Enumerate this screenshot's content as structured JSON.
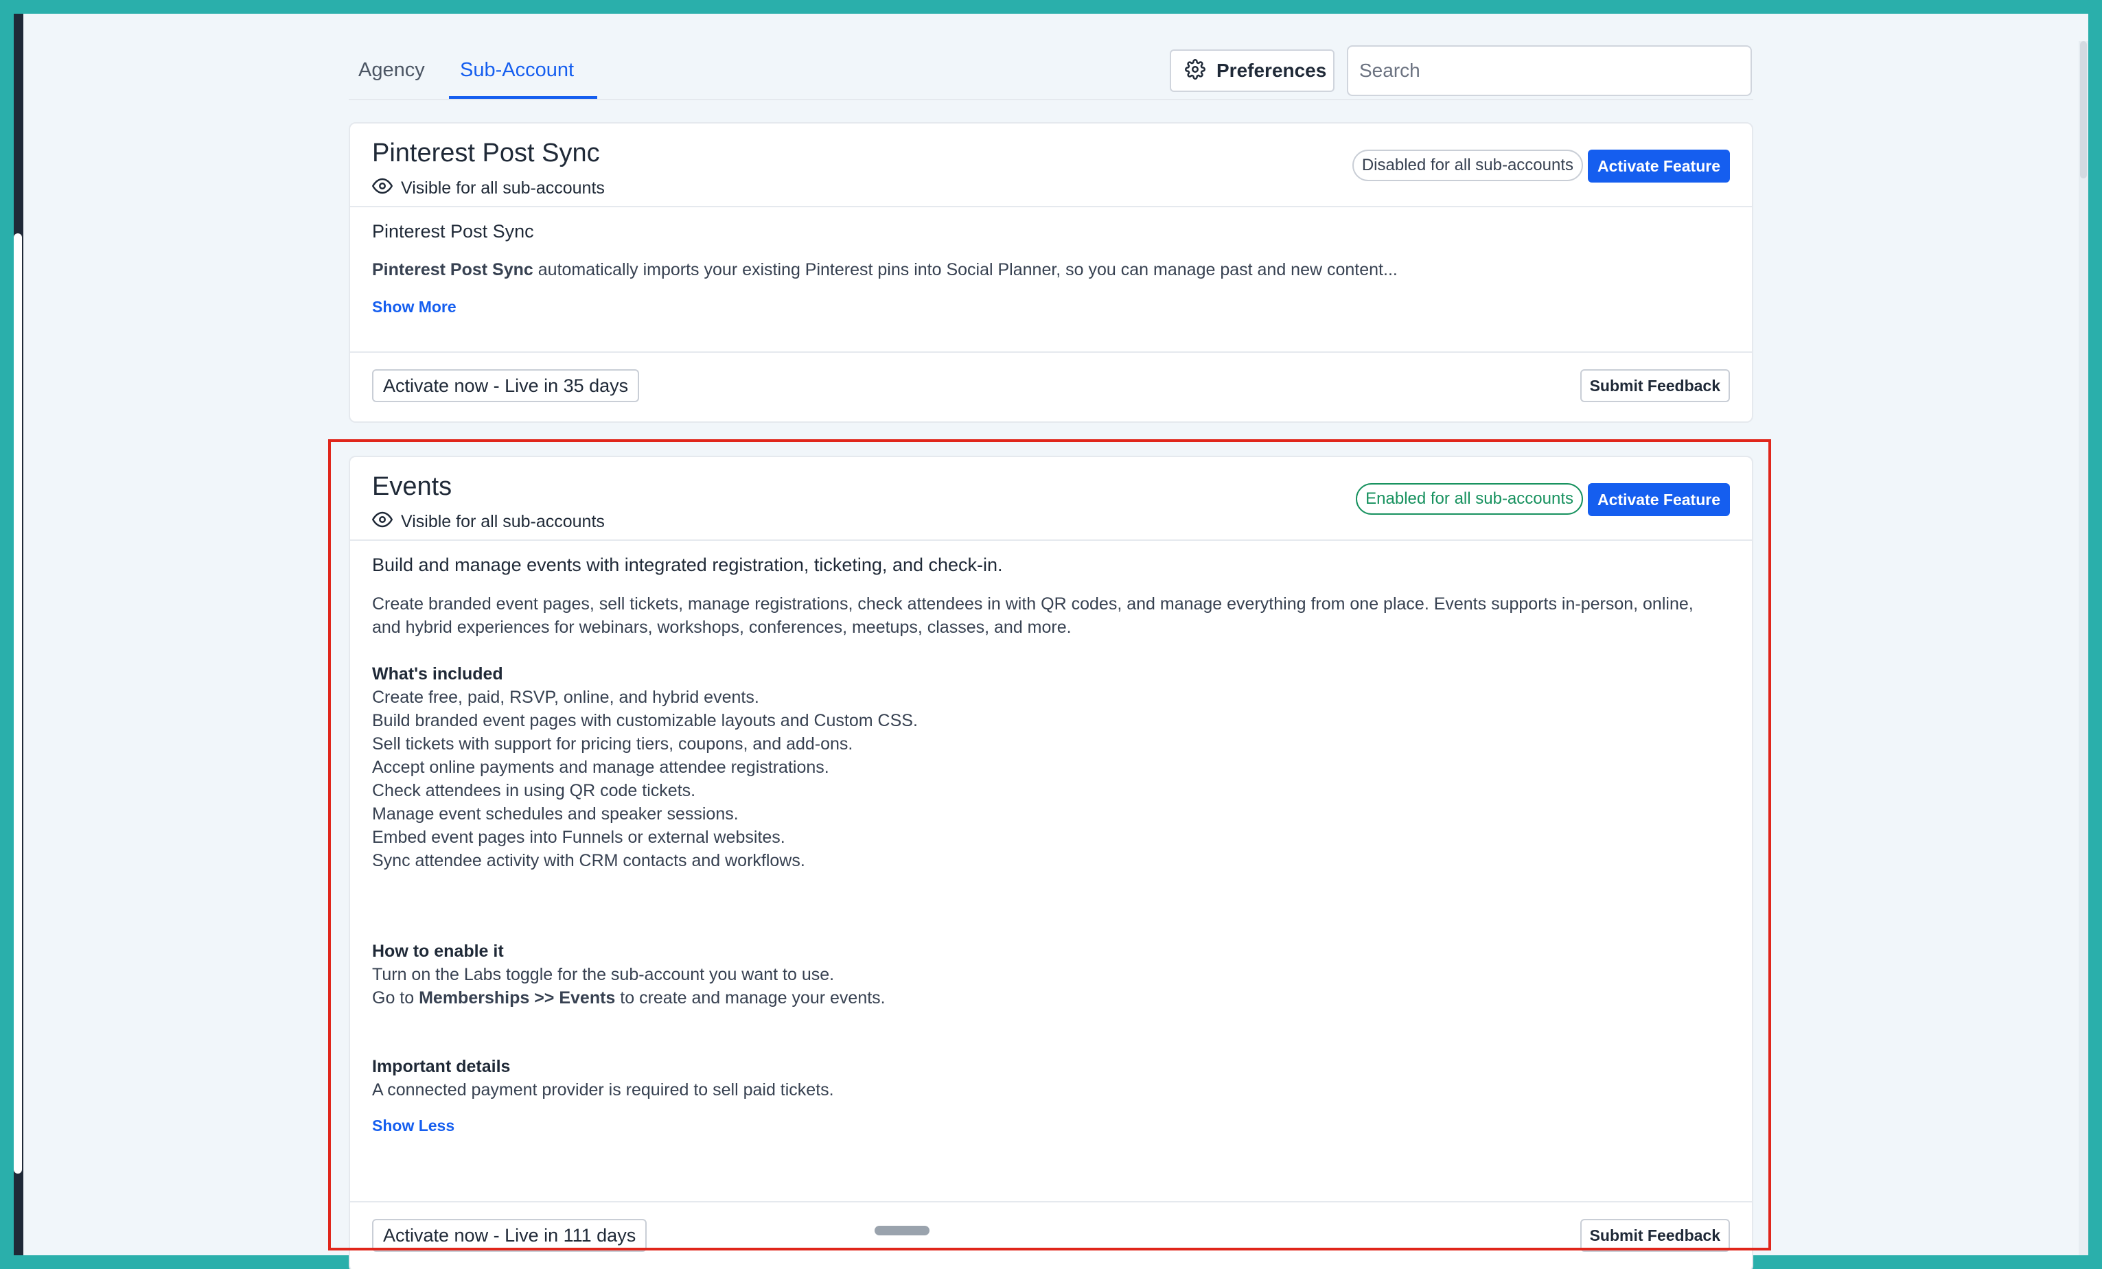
{
  "tabs": {
    "agency": "Agency",
    "sub_account": "Sub-Account"
  },
  "toolbar": {
    "preferences_label": "Preferences",
    "search_placeholder": "Search"
  },
  "cards": [
    {
      "title": "Pinterest Post Sync",
      "visibility": "Visible for all sub-accounts",
      "status": "Disabled for all sub-accounts",
      "activate_label": "Activate Feature",
      "subtitle": "Pinterest Post Sync",
      "desc_bold": "Pinterest Post Sync",
      "desc_rest": " automatically imports your existing Pinterest pins into Social Planner, so you can manage past and new content...",
      "toggle_label": "Show More",
      "live_label": "Activate now - Live in 35 days",
      "feedback_label": "Submit Feedback"
    },
    {
      "title": "Events",
      "visibility": "Visible for all sub-accounts",
      "status": "Enabled for all sub-accounts",
      "activate_label": "Activate Feature",
      "lead": "Build and manage events with integrated registration, ticketing, and check-in.",
      "intro_line1": "Create branded event pages, sell tickets, manage registrations, check attendees in with QR codes, and manage everything from one place. Events supports in-person, online,",
      "intro_line2": "and hybrid experiences for webinars, workshops, conferences, meetups, classes, and more.",
      "included_heading": "What's included",
      "included_items": [
        "Create free, paid, RSVP, online, and hybrid events.",
        "Build branded event pages with customizable layouts and Custom CSS.",
        "Sell tickets with support for pricing tiers, coupons, and add-ons.",
        "Accept online payments and manage attendee registrations.",
        "Check attendees in using QR code tickets.",
        "Manage event schedules and speaker sessions.",
        "Embed event pages into Funnels or external websites.",
        "Sync attendee activity with CRM contacts and workflows."
      ],
      "enable_heading": "How to enable it",
      "enable_line1": "Turn on the Labs toggle for the sub-account you want to use.",
      "enable_line2_pre": "Go to ",
      "enable_line2_bold": "Memberships >> Events",
      "enable_line2_post": " to create and manage your events.",
      "details_heading": "Important details",
      "details_line": "A connected payment provider is required to sell paid tickets.",
      "toggle_label": "Show Less",
      "live_label": "Activate now - Live in 111 days",
      "feedback_label": "Submit Feedback"
    }
  ]
}
